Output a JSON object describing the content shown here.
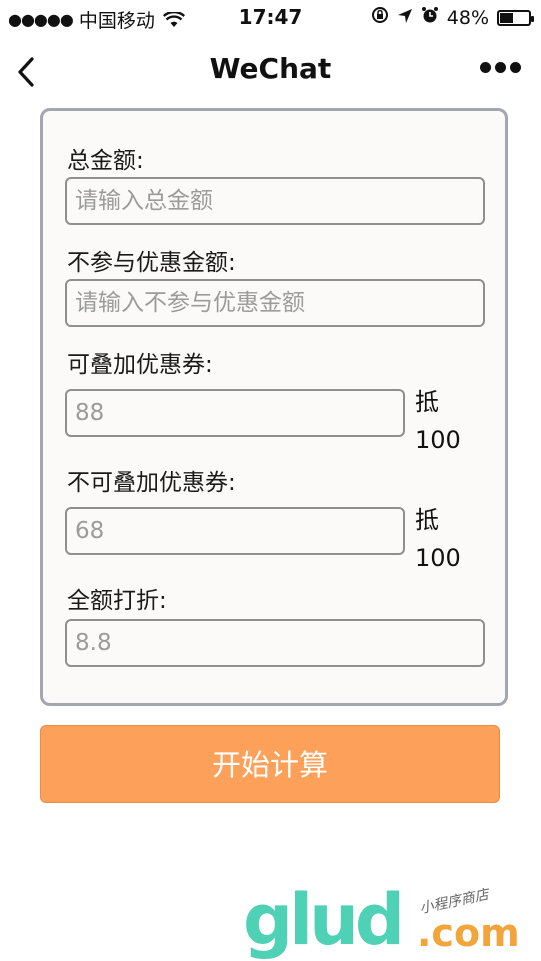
{
  "status_bar": {
    "carrier": "中国移动",
    "time": "17:47",
    "battery_percent": "48%",
    "battery_level": 0.48
  },
  "nav": {
    "title": "WeChat",
    "back_icon": "chevron-left-icon",
    "more_icon": "more-dots-icon"
  },
  "form": {
    "total": {
      "label": "总金额:",
      "placeholder": "请输入总金额"
    },
    "excluded": {
      "label": "不参与优惠金额:",
      "placeholder": "请输入不参与优惠金额"
    },
    "stackable": {
      "label": "可叠加优惠券:",
      "placeholder": "88",
      "suffix_char": "抵",
      "suffix_value": "100"
    },
    "nonstackable": {
      "label": "不可叠加优惠券:",
      "placeholder": "68",
      "suffix_char": "抵",
      "suffix_value": "100"
    },
    "discount": {
      "label": "全额打折:",
      "placeholder": "8.8"
    }
  },
  "calculate_button": {
    "label": "开始计算",
    "color": "#fda15a"
  },
  "watermark": {
    "logo": "glud",
    "domain": ".com",
    "tagline": "小程序商店"
  },
  "colors": {
    "card_border": "#a3a6b0",
    "accent": "#fda15a"
  }
}
